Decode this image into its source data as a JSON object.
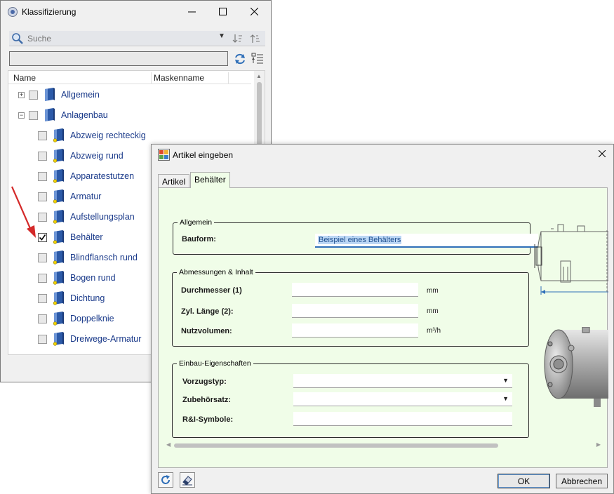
{
  "classification_window": {
    "title": "Klassifizierung",
    "search_placeholder": "Suche",
    "filter_value": "",
    "columns": [
      "Name",
      "Maskenname"
    ],
    "tree": [
      {
        "label": "Allgemein",
        "level": 0,
        "expander": "+",
        "checked": false
      },
      {
        "label": "Anlagenbau",
        "level": 0,
        "expander": "−",
        "checked": false
      },
      {
        "label": "Abzweig rechteckig",
        "level": 1,
        "checked": false
      },
      {
        "label": "Abzweig rund",
        "level": 1,
        "checked": false
      },
      {
        "label": "Apparatestutzen",
        "level": 1,
        "checked": false
      },
      {
        "label": "Armatur",
        "level": 1,
        "checked": false
      },
      {
        "label": "Aufstellungsplan",
        "level": 1,
        "checked": false
      },
      {
        "label": "Behälter",
        "level": 1,
        "checked": true
      },
      {
        "label": "Blindflansch rund",
        "level": 1,
        "checked": false
      },
      {
        "label": "Bogen rund",
        "level": 1,
        "checked": false
      },
      {
        "label": "Dichtung",
        "level": 1,
        "checked": false
      },
      {
        "label": "Doppelknie",
        "level": 1,
        "checked": false
      },
      {
        "label": "Dreiwege-Armatur",
        "level": 1,
        "checked": false
      }
    ]
  },
  "article_dialog": {
    "title": "Artikel eingeben",
    "tabs": [
      "Artikel",
      "Behälter"
    ],
    "active_tab": "Behälter",
    "group_allgemein": {
      "legend": "Allgemein",
      "bauform_label": "Bauform:",
      "bauform_value": "Beispiel eines Behälters"
    },
    "group_abmessungen": {
      "legend": "Abmessungen & Inhalt",
      "durchmesser_label": "Durchmesser (1)",
      "durchmesser_unit": "mm",
      "laenge_label": "Zyl. Länge (2):",
      "laenge_unit": "mm",
      "volumen_label": "Nutzvolumen:",
      "volumen_unit": "m³/h"
    },
    "group_einbau": {
      "legend": "Einbau-Eigenschaften",
      "vorzugstyp_label": "Vorzugstyp:",
      "zubehoer_label": "Zubehörsatz:",
      "ri_label": "R&I-Symbole:"
    },
    "ok_label": "OK",
    "cancel_label": "Abbrechen"
  },
  "colors": {
    "panel_bg": "#f0fde8",
    "tree_text": "#1a3a8a",
    "selection": "#bcd7f5",
    "arrow": "#d42a2a"
  }
}
